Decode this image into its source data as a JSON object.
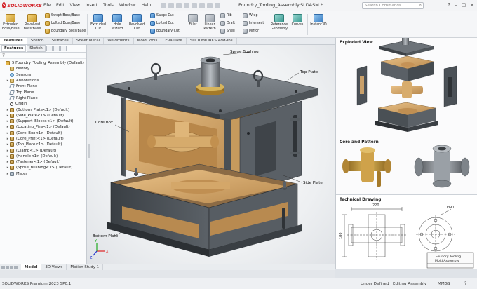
{
  "app": {
    "brand": "SOLIDWORKS",
    "document_title": "Foundry_Tooling_Assembly.SLDASM *",
    "menu": [
      "File",
      "Edit",
      "View",
      "Insert",
      "Tools",
      "Window",
      "Help"
    ],
    "search_placeholder": "Search Commands"
  },
  "ribbon": {
    "extruded_boss": "Extruded Boss/Base",
    "revolved_boss": "Revolved Boss/Base",
    "swept_boss": "Swept Boss/Base",
    "lofted_boss": "Lofted Boss/Base",
    "boundary_boss": "Boundary Boss/Base",
    "extruded_cut": "Extruded Cut",
    "hole_wizard": "Hole Wizard",
    "revolved_cut": "Revolved Cut",
    "swept_cut": "Swept Cut",
    "lofted_cut": "Lofted Cut",
    "boundary_cut": "Boundary Cut",
    "fillet": "Fillet",
    "linear_pattern": "Linear Pattern",
    "rib": "Rib",
    "draft": "Draft",
    "shell": "Shell",
    "wrap": "Wrap",
    "intersect": "Intersect",
    "mirror": "Mirror",
    "reference_geometry": "Reference Geometry",
    "curves": "Curves",
    "instant3d": "Instant3D"
  },
  "command_tabs": [
    "Features",
    "Sketch",
    "Surfaces",
    "Sheet Metal",
    "Weldments",
    "Mold Tools",
    "Evaluate",
    "SOLIDWORKS Add-Ins"
  ],
  "left_panel": {
    "tabs": [
      "Features",
      "Sketch"
    ],
    "tree": [
      {
        "label": "5 Foundry_Tooling_Assembly  (Default)",
        "icon": "asm",
        "level": 0,
        "expander": ""
      },
      {
        "label": "History",
        "icon": "fold",
        "level": 1,
        "expander": ""
      },
      {
        "label": "Sensors",
        "icon": "sens",
        "level": 1,
        "expander": ""
      },
      {
        "label": "Annotations",
        "icon": "fold",
        "level": 1,
        "expander": "▸"
      },
      {
        "label": "Front Plane",
        "icon": "plane",
        "level": 1,
        "expander": ""
      },
      {
        "label": "Top Plane",
        "icon": "plane",
        "level": 1,
        "expander": ""
      },
      {
        "label": "Right Plane",
        "icon": "plane",
        "level": 1,
        "expander": ""
      },
      {
        "label": "Origin",
        "icon": "orig",
        "level": 1,
        "expander": ""
      },
      {
        "label": "(Bottom_Plate<1> (Default)",
        "icon": "part",
        "level": 1,
        "expander": "▸"
      },
      {
        "label": "(Side_Plate<1> (Default)",
        "icon": "part",
        "level": 1,
        "expander": "▸"
      },
      {
        "label": "(Support_Blocks<1> (Default)",
        "icon": "part",
        "level": 1,
        "expander": "▸"
      },
      {
        "label": "(Locating_Pins<1> (Default)",
        "icon": "part",
        "level": 1,
        "expander": "▸"
      },
      {
        "label": "(Core_Box<1> (Default)",
        "icon": "part",
        "level": 1,
        "expander": "▸"
      },
      {
        "label": "(Core_Print<1> (Default)",
        "icon": "part",
        "level": 1,
        "expander": "▸"
      },
      {
        "label": "(Top_Plate<1> (Default)",
        "icon": "part",
        "level": 1,
        "expander": "▸"
      },
      {
        "label": "(Clamp<1> (Default)",
        "icon": "part",
        "level": 1,
        "expander": "▸"
      },
      {
        "label": "(Handle<1> (Default)",
        "icon": "part",
        "level": 1,
        "expander": "▸"
      },
      {
        "label": "(Fastener<1> (Default)",
        "icon": "part",
        "level": 1,
        "expander": "▸"
      },
      {
        "label": "(Sprue_Bushing<1> (Default)",
        "icon": "part",
        "level": 1,
        "expander": "▸"
      },
      {
        "label": "Mates",
        "icon": "mate",
        "level": 1,
        "expander": "▸"
      }
    ]
  },
  "viewport": {
    "callouts": {
      "sprue_bushing": "Sprue Bushing",
      "top_plate": "Top Plate",
      "core_box": "Core Box",
      "side_plate": "Side Plate",
      "bottom_plate": "Bottom Plate"
    },
    "triad": {
      "x": "X",
      "y": "Y",
      "z": "Z"
    }
  },
  "right_panel": {
    "exploded_view": "Exploded View",
    "core_and_pattern": "Core and Pattern",
    "technical_drawing": "Technical Drawing",
    "drawing": {
      "dim_width": "220",
      "dim_height": "180",
      "dim_diameter": "Ø90",
      "title_block_line1": "Foundry Tooling",
      "title_block_line2": "Mold Assembly"
    }
  },
  "bottom_tabs": [
    "Model",
    "3D Views",
    "Motion Study 1"
  ],
  "status": {
    "version": "SOLIDWORKS Premium 2023 SP0.1",
    "definition": "Under Defined",
    "mode": "Editing Assembly",
    "units": "MMGS"
  },
  "colors": {
    "brand_red": "#d2232a",
    "steel_dark": "#4b5056",
    "steel_mid": "#7a8087",
    "sand": "#d6aa6e",
    "brass": "#c89a3c"
  }
}
